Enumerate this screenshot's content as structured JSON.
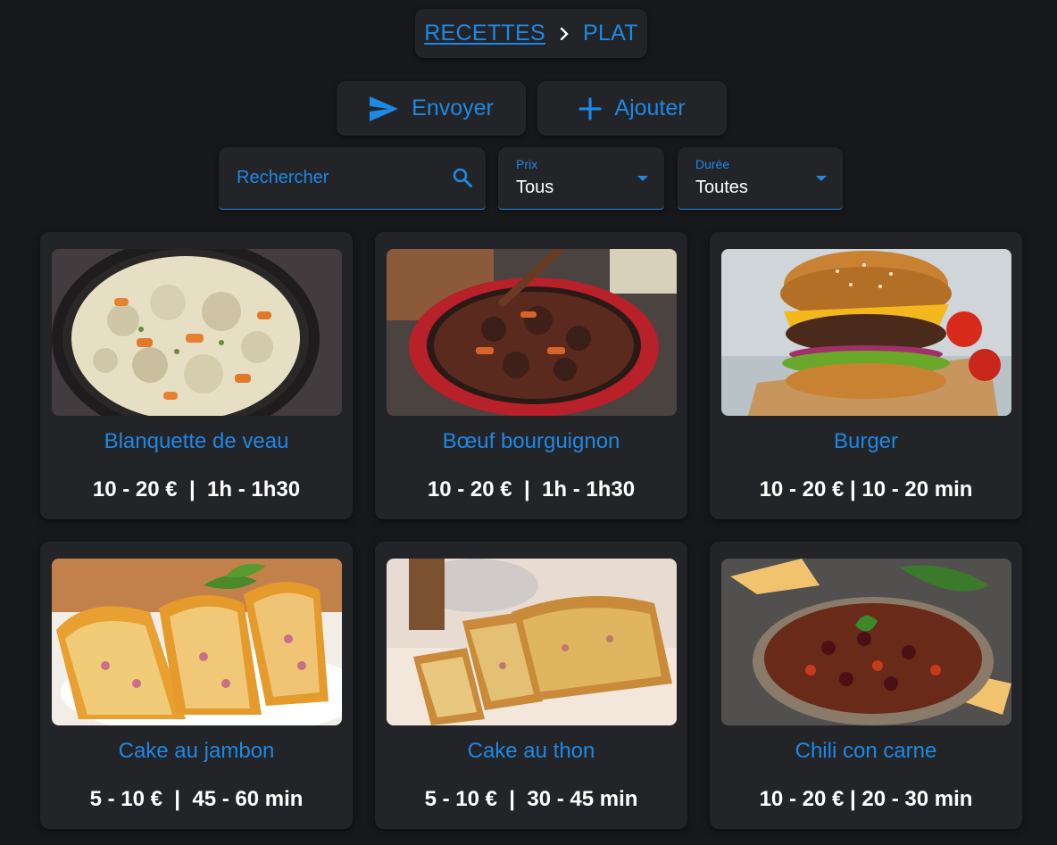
{
  "breadcrumb": {
    "root": "RECETTES",
    "current": "PLAT"
  },
  "actions": {
    "send_label": "Envoyer",
    "add_label": "Ajouter"
  },
  "filters": {
    "search_placeholder": "Rechercher",
    "price": {
      "label": "Prix",
      "value": "Tous"
    },
    "duration": {
      "label": "Durée",
      "value": "Toutes"
    }
  },
  "colors": {
    "accent": "#1e88e5",
    "background": "#17181b",
    "surface": "#232427"
  },
  "recipes": [
    {
      "title": "Blanquette de veau",
      "meta": "10 - 20 €  |  1h - 1h30",
      "image": "creamy-veal-stew-in-pot"
    },
    {
      "title": "Bœuf bourguignon",
      "meta": "10 - 20 €  |  1h - 1h30",
      "image": "beef-stew-in-red-casserole"
    },
    {
      "title": "Burger",
      "meta": "10 - 20 € | 10 - 20 min",
      "image": "cheeseburger"
    },
    {
      "title": "Cake au jambon",
      "meta": "5 - 10 €  |  45 - 60 min",
      "image": "ham-loaf-slices"
    },
    {
      "title": "Cake au thon",
      "meta": "5 - 10 €  |  30 - 45 min",
      "image": "tuna-loaf-slices"
    },
    {
      "title": "Chili con carne",
      "meta": "10 - 20 € | 20 - 30 min",
      "image": "chili-bowl"
    }
  ]
}
